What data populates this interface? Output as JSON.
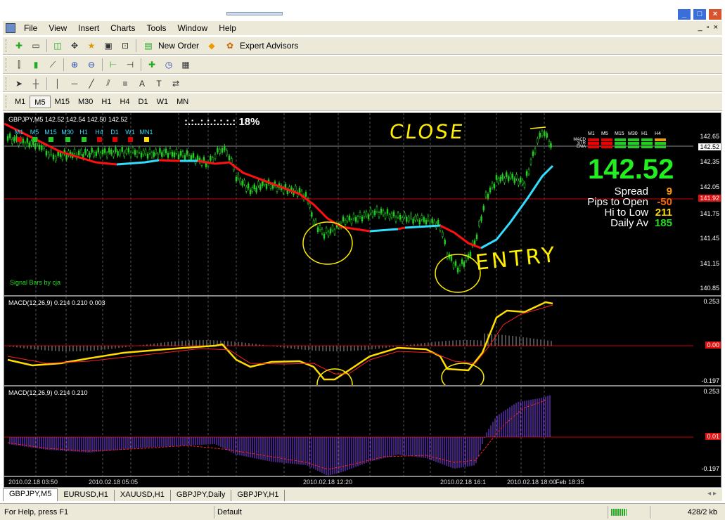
{
  "menu": [
    "File",
    "View",
    "Insert",
    "Charts",
    "Tools",
    "Window",
    "Help"
  ],
  "mdi_controls": [
    "_",
    "▫",
    "×"
  ],
  "toolbar1": {
    "new_order": "New Order",
    "expert_advisors": "Expert Advisors"
  },
  "timeframes": [
    "M1",
    "M5",
    "M15",
    "M30",
    "H1",
    "H4",
    "D1",
    "W1",
    "MN"
  ],
  "active_timeframe": "M5",
  "chart": {
    "header": "GBPJPY,M5  142.52 142.54 142.50 142.52",
    "progress_text": ":.:..:.:.:.:.:.:  18%",
    "signal_tfs": [
      "M1",
      "M5",
      "M15",
      "M30",
      "H1",
      "H4",
      "D1",
      "W1",
      "MN1"
    ],
    "signal_colors": [
      "#e00000",
      "#22cc22",
      "#22cc22",
      "#22cc22",
      "#22cc22",
      "#e00000",
      "#e00000",
      "#e00000",
      "#ffdd00"
    ],
    "footer": "Signal Bars by cja",
    "annot_close": "CLOSE",
    "annot_entry": "ENTRY",
    "price_labels": [
      "142.65",
      "142.35",
      "142.05",
      "141.75",
      "141.45",
      "141.15",
      "140.85"
    ],
    "current_price_box": "142.52",
    "red_price_box": "141.92",
    "big_price": "142.52",
    "panel_tfs": [
      "M1",
      "M5",
      "M15",
      "M30",
      "H1",
      "H4"
    ],
    "panel_rows": [
      "MACD",
      "STR",
      "EMA"
    ],
    "stats": [
      {
        "label": "Spread",
        "value": "9",
        "color": "#ff9900"
      },
      {
        "label": "Pips to Open",
        "value": "-50",
        "color": "#ff6600"
      },
      {
        "label": "Hi to Low",
        "value": "211",
        "color": "#ffd700"
      },
      {
        "label": "Daily Av",
        "value": "185",
        "color": "#22dd22"
      }
    ]
  },
  "macd1": {
    "label": "MACD(12,26,9) 0.214 0.210 0.003",
    "top": "0.253",
    "zero": "0.00",
    "bottom": "-0.197"
  },
  "macd2": {
    "label": "MACD(12,26,9) 0.214 0.210",
    "top": "0.253",
    "zero": "0.01",
    "bottom": "-0.197"
  },
  "time_axis": [
    "2010.02.18 03:50",
    "2010.02.18 05:05",
    "2010.02.18 12:20",
    "2010.02.18 16:1",
    "2010.02.18 18:00",
    "Feb 18:35"
  ],
  "tabs": [
    "GBPJPY,M5",
    "EURUSD,H1",
    "XAUUSD,H1",
    "GBPJPY,Daily",
    "GBPJPY,H1"
  ],
  "status": {
    "help": "For Help, press F1",
    "profile": "Default",
    "traffic": "428/2 kb"
  },
  "colors": {
    "ma_down": "#ff1010",
    "ma_up": "#33ddff",
    "macd_main": "#ffdd00",
    "macd_signal": "#ff2020",
    "hist2": "#8844ff",
    "annot": "#ffee00"
  }
}
